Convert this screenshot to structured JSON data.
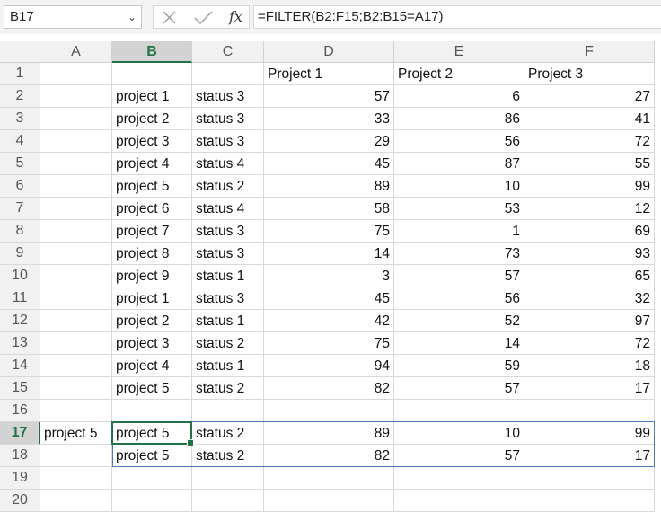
{
  "name_box": "B17",
  "formula": "=FILTER(B2:F15;B2:B15=A17)",
  "columns": [
    "A",
    "B",
    "C",
    "D",
    "E",
    "F"
  ],
  "selected_column": "B",
  "selected_row": "17",
  "rows": [
    {
      "n": "1",
      "cells": [
        "",
        "",
        "",
        "Project 1",
        "Project 2",
        "Project 3"
      ]
    },
    {
      "n": "2",
      "cells": [
        "",
        "project 1",
        "status 3",
        "57",
        "6",
        "27"
      ]
    },
    {
      "n": "3",
      "cells": [
        "",
        "project 2",
        "status 3",
        "33",
        "86",
        "41"
      ]
    },
    {
      "n": "4",
      "cells": [
        "",
        "project 3",
        "status 3",
        "29",
        "56",
        "72"
      ]
    },
    {
      "n": "5",
      "cells": [
        "",
        "project 4",
        "status 4",
        "45",
        "87",
        "55"
      ]
    },
    {
      "n": "6",
      "cells": [
        "",
        "project 5",
        "status 2",
        "89",
        "10",
        "99"
      ]
    },
    {
      "n": "7",
      "cells": [
        "",
        "project 6",
        "status 4",
        "58",
        "53",
        "12"
      ]
    },
    {
      "n": "8",
      "cells": [
        "",
        "project 7",
        "status 3",
        "75",
        "1",
        "69"
      ]
    },
    {
      "n": "9",
      "cells": [
        "",
        "project 8",
        "status 3",
        "14",
        "73",
        "93"
      ]
    },
    {
      "n": "10",
      "cells": [
        "",
        "project 9",
        "status 1",
        "3",
        "57",
        "65"
      ]
    },
    {
      "n": "11",
      "cells": [
        "",
        "project 1",
        "status 3",
        "45",
        "56",
        "32"
      ]
    },
    {
      "n": "12",
      "cells": [
        "",
        "project 2",
        "status 1",
        "42",
        "52",
        "97"
      ]
    },
    {
      "n": "13",
      "cells": [
        "",
        "project 3",
        "status 2",
        "75",
        "14",
        "72"
      ]
    },
    {
      "n": "14",
      "cells": [
        "",
        "project 4",
        "status 1",
        "94",
        "59",
        "18"
      ]
    },
    {
      "n": "15",
      "cells": [
        "",
        "project 5",
        "status 2",
        "82",
        "57",
        "17"
      ]
    },
    {
      "n": "16",
      "cells": [
        "",
        "",
        "",
        "",
        "",
        ""
      ]
    },
    {
      "n": "17",
      "cells": [
        "project 5",
        "project 5",
        "status 2",
        "89",
        "10",
        "99"
      ]
    },
    {
      "n": "18",
      "cells": [
        "",
        "project 5",
        "status 2",
        "82",
        "57",
        "17"
      ]
    },
    {
      "n": "19",
      "cells": [
        "",
        "",
        "",
        "",
        "",
        ""
      ]
    },
    {
      "n": "20",
      "cells": [
        "",
        "",
        "",
        "",
        "",
        ""
      ]
    }
  ]
}
